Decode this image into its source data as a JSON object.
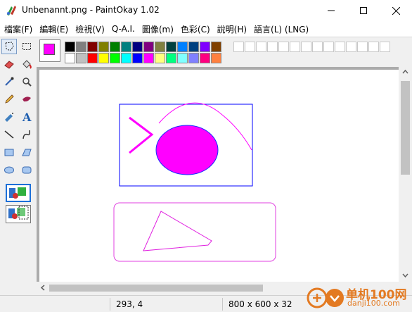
{
  "window": {
    "title": "Unbenannt.png - PaintOkay 1.02"
  },
  "menu": [
    "檔案(F)",
    "編輯(E)",
    "檢視(V)",
    "Q-A.I.",
    "圖像(m)",
    "色彩(C)",
    "說明(H)",
    "語言(L) (LNG)"
  ],
  "colors": {
    "foreground": "#ff00ff",
    "background": "#ffffff",
    "palette_row1": [
      "#000000",
      "#808080",
      "#800000",
      "#808000",
      "#008000",
      "#008080",
      "#000080",
      "#800080",
      "#808040",
      "#004040",
      "#0080ff",
      "#004080",
      "#8000ff",
      "#804000"
    ],
    "palette_row2": [
      "#ffffff",
      "#c0c0c0",
      "#ff0000",
      "#ffff00",
      "#00ff00",
      "#00ffff",
      "#0000ff",
      "#ff00ff",
      "#ffff80",
      "#00ff80",
      "#80ffff",
      "#8080ff",
      "#ff0080",
      "#ff8040"
    ],
    "custom_count": 14
  },
  "status": {
    "coords": "293, 4",
    "size": "800 x 600 x 32"
  },
  "watermark": {
    "line1": "单机100网",
    "line2": "danji100.com"
  }
}
